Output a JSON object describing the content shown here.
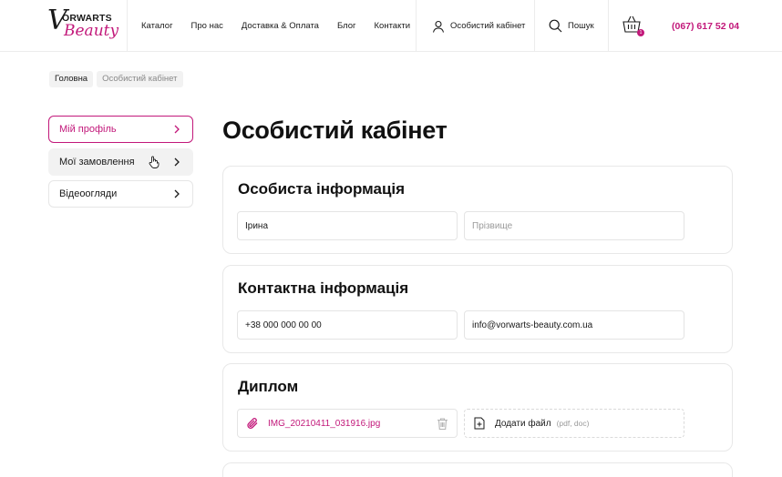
{
  "brand": {
    "top": "ORWARTS",
    "v": "V",
    "bottom": "Beauty"
  },
  "nav": [
    "Каталог",
    "Про нас",
    "Доставка & Оплата",
    "Блог",
    "Контакти"
  ],
  "account_label": "Особистий кабінет",
  "search_label": "Пошук",
  "cart_count": "1",
  "phone": "(067) 617 52 04",
  "breadcrumb": {
    "home": "Головна",
    "current": "Особистий кабінет"
  },
  "sidebar": [
    "Мій профіль",
    "Мої замовлення",
    "Відеоогляди"
  ],
  "page_title": "Особистий кабінет",
  "personal": {
    "title": "Особиста інформація",
    "first_name": "Ірина",
    "last_name_placeholder": "Прізвище"
  },
  "contact": {
    "title": "Контактна інформація",
    "phone": "+38 000 000 00 00",
    "email": "info@vorwarts-beauty.com.ua"
  },
  "diploma": {
    "title": "Диплом",
    "file_name": "IMG_20210411_031916.jpg",
    "add_label": "Додати файл",
    "add_hint": "(pdf, doc)"
  },
  "colors": {
    "accent": "#c2187a",
    "border": "#e8e8e8"
  }
}
